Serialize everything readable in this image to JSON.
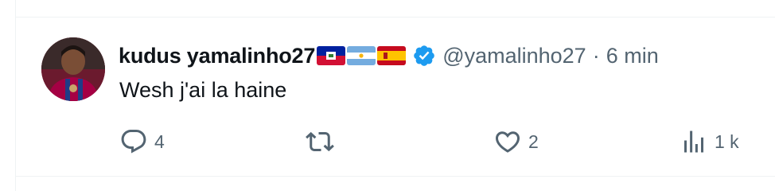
{
  "tweet": {
    "display_name": "kudus yamalinho27",
    "flags": [
      "haiti-flag",
      "argentina-flag",
      "spain-flag"
    ],
    "verified_icon": "verified-badge-icon",
    "handle": "@yamalinho27",
    "separator": "·",
    "time": "6 min",
    "text": "Wesh j'ai la haine"
  },
  "actions": {
    "reply_count": "4",
    "retweet_count": "",
    "like_count": "2",
    "views_count": "1 k"
  },
  "colors": {
    "verified": "#1d9bf0",
    "muted_text": "#536471",
    "main_text": "#0f1419",
    "divider": "#eff3f4"
  }
}
